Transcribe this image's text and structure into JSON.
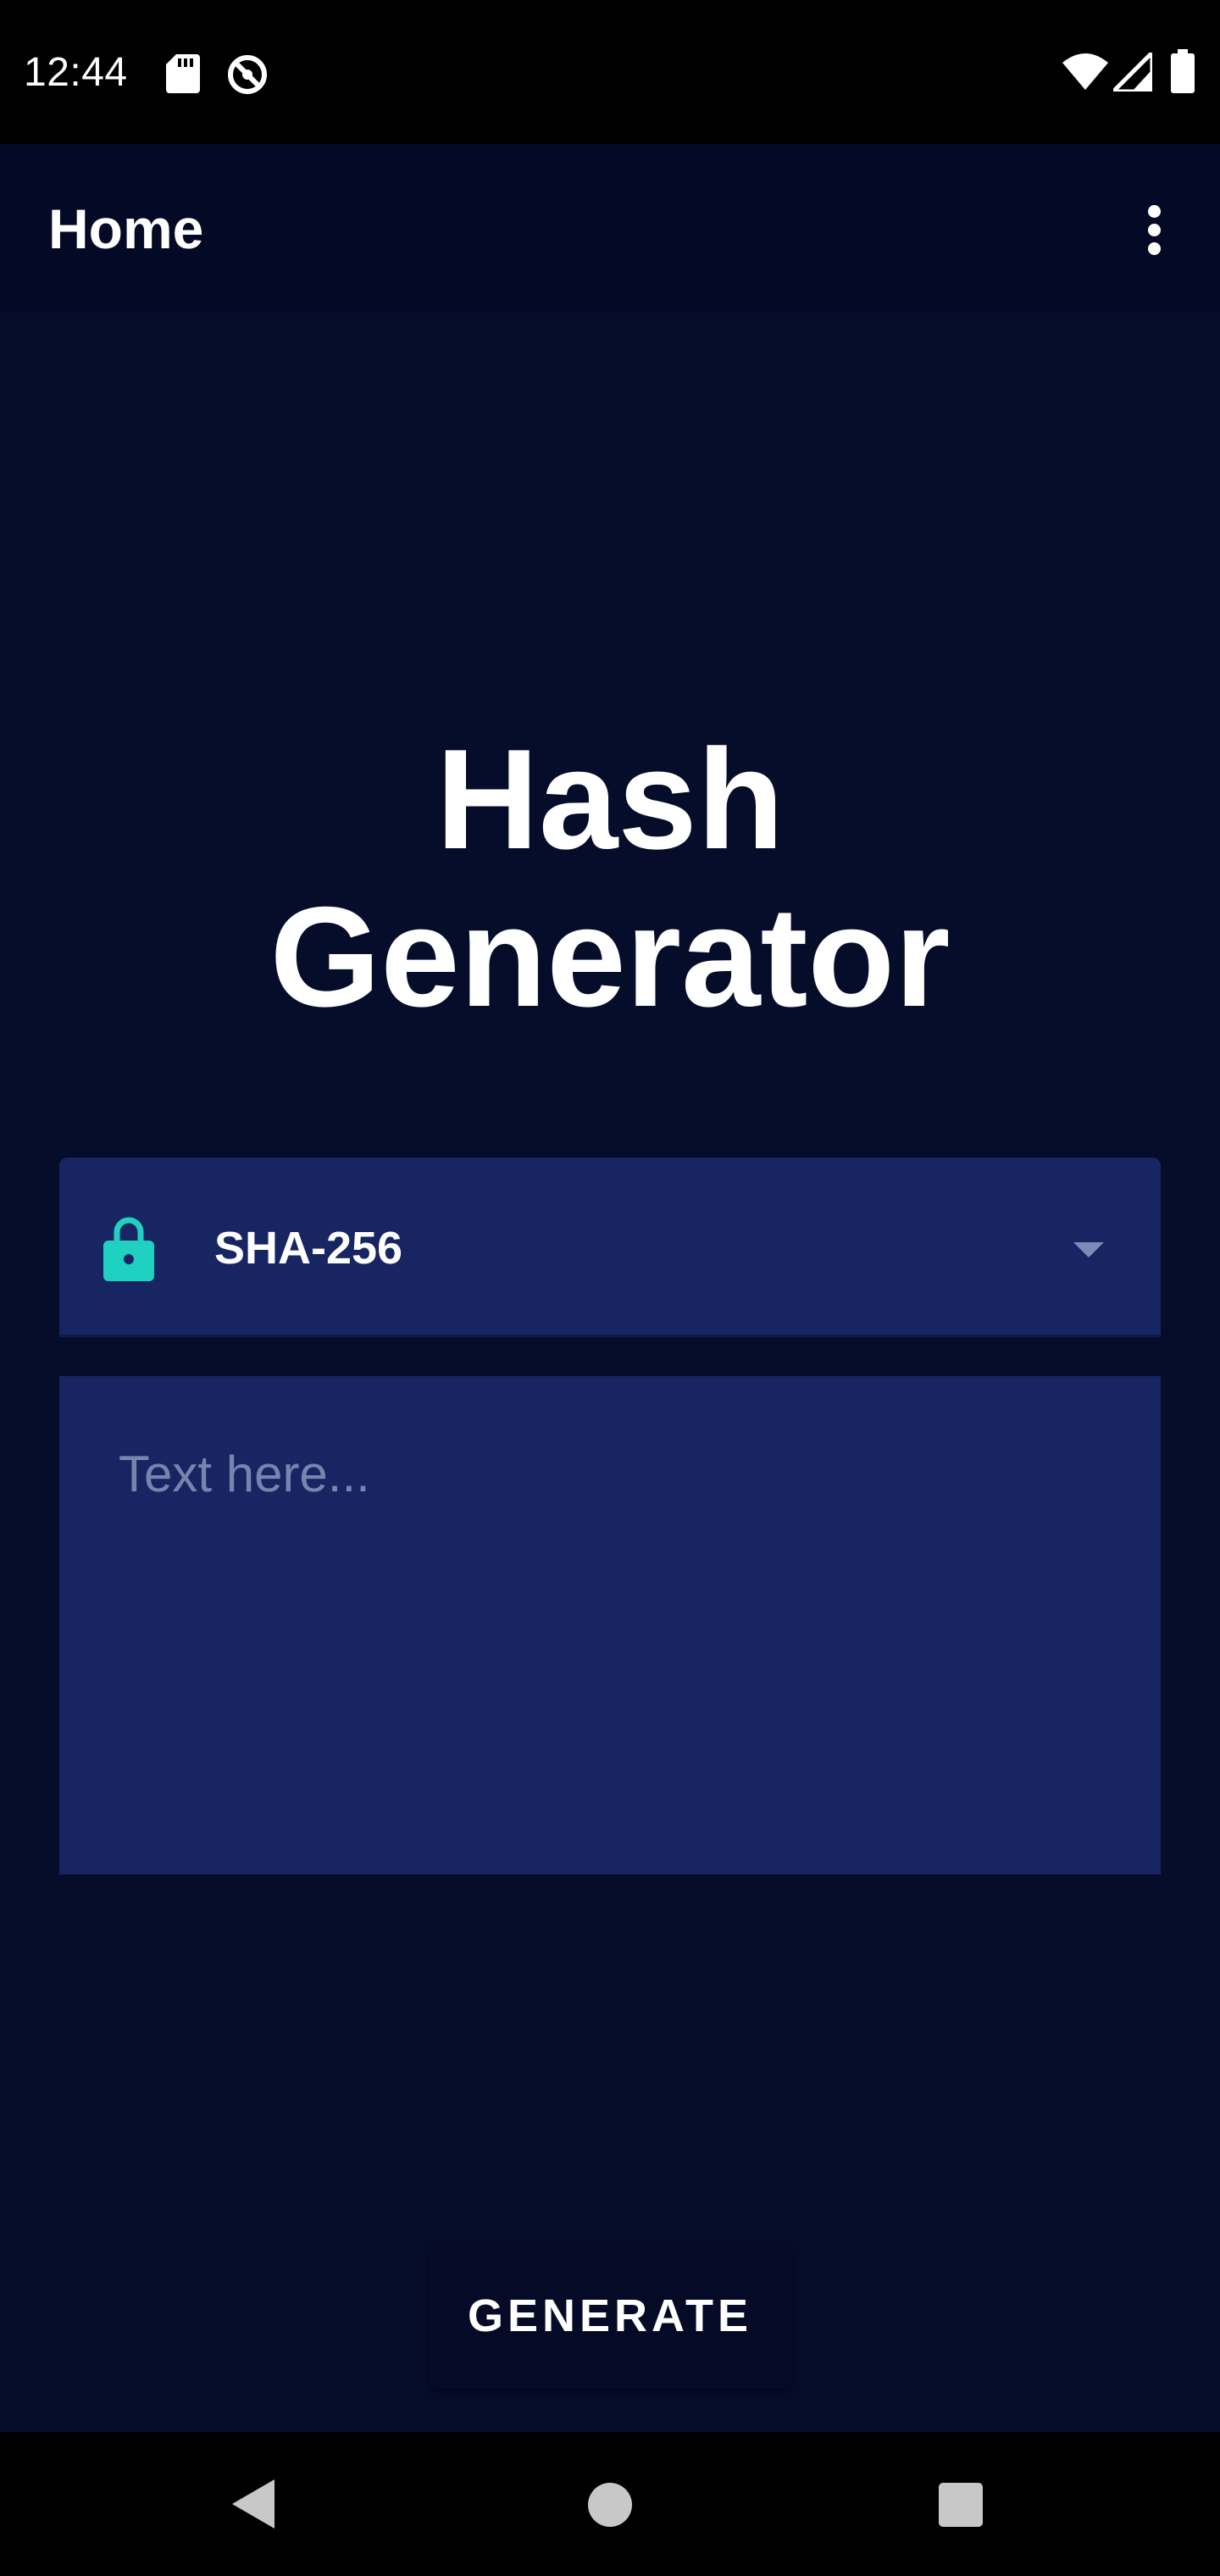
{
  "status_bar": {
    "time": "12:44",
    "icons": [
      "sd-card-icon",
      "sync-icon",
      "wifi-icon",
      "cellular-signal-icon",
      "battery-icon"
    ]
  },
  "app_bar": {
    "title": "Home",
    "menu_icon": "more-vert-icon"
  },
  "heading": {
    "line1": "Hash",
    "line2": "Generator"
  },
  "algorithm_dropdown": {
    "icon": "lock-icon",
    "selected": "SHA-256"
  },
  "input": {
    "placeholder": "Text here...",
    "value": ""
  },
  "generate_button": {
    "label": "GENERATE"
  },
  "nav_bar": {
    "icons": [
      "back-icon",
      "home-icon",
      "recents-icon"
    ]
  },
  "colors": {
    "background": "#060D2B",
    "app_bar": "#040A25",
    "field": "#172662",
    "accent": "#1FD1C1",
    "placeholder": "#7984AE"
  }
}
